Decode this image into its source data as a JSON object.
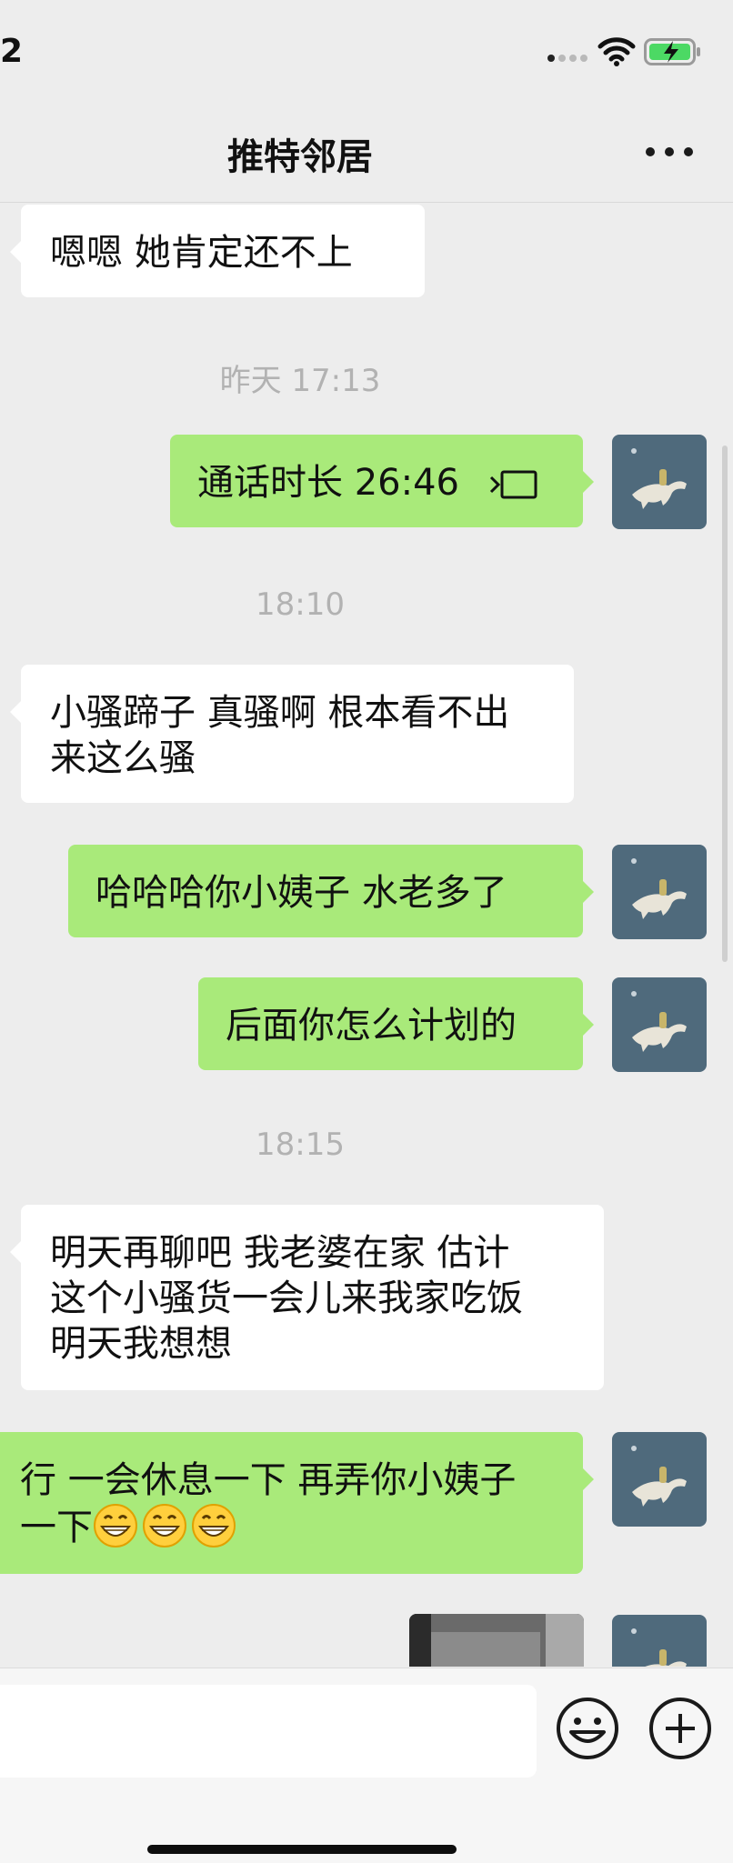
{
  "status_bar": {
    "time": "2"
  },
  "header": {
    "title": "推特邻居"
  },
  "chat": {
    "messages": [
      {
        "side": "left",
        "text": "嗯嗯 她肯定还不上"
      },
      {
        "type": "time",
        "text": "昨天 17:13"
      },
      {
        "side": "right",
        "text": "通话时长 26:46",
        "icon": "voice-call-icon"
      },
      {
        "type": "time",
        "text": "18:10"
      },
      {
        "side": "left",
        "text": "小骚蹄子 真骚啊 根本看不出\n来这么骚"
      },
      {
        "side": "right",
        "text": "哈哈哈你小姨子 水老多了"
      },
      {
        "side": "right",
        "text": "后面你怎么计划的"
      },
      {
        "type": "time",
        "text": "18:15"
      },
      {
        "side": "left",
        "text": "明天再聊吧 我老婆在家 估计\n这个小骚货一会儿来我家吃饭\n明天我想想"
      },
      {
        "side": "right",
        "text": "行 一会休息一下 再弄你小姨子\n一下",
        "emoji": "grin-emoji",
        "emoji_count": 3
      },
      {
        "side": "right",
        "type": "image",
        "icon": "photo-thumbnail"
      }
    ]
  },
  "colors": {
    "background": "#ededed",
    "bubble_self": "#a9ea7a",
    "bubble_other": "#ffffff",
    "timestamp": "#b2b2b2"
  },
  "input_bar": {
    "placeholder": "",
    "emoji_icon": "smiley-face-icon",
    "plus_icon": "plus-circle-icon"
  }
}
